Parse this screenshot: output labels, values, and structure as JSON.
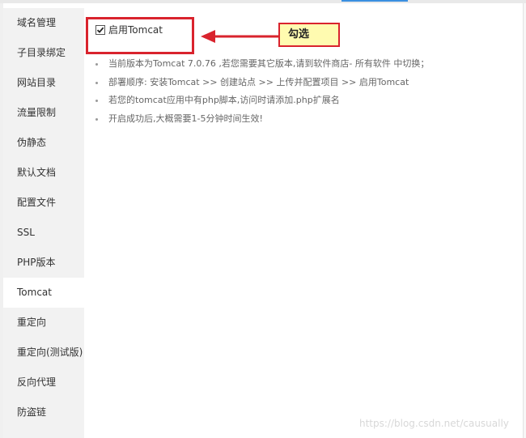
{
  "sidebar": {
    "items": [
      {
        "label": "域名管理"
      },
      {
        "label": "子目录绑定"
      },
      {
        "label": "网站目录"
      },
      {
        "label": "流量限制"
      },
      {
        "label": "伪静态"
      },
      {
        "label": "默认文档"
      },
      {
        "label": "配置文件"
      },
      {
        "label": "SSL"
      },
      {
        "label": "PHP版本"
      },
      {
        "label": "Tomcat"
      },
      {
        "label": "重定向"
      },
      {
        "label": "重定向(测试版)"
      },
      {
        "label": "反向代理"
      },
      {
        "label": "防盗链"
      }
    ],
    "active_index": 9
  },
  "tomcat": {
    "enable_label": "启用Tomcat",
    "enabled": true
  },
  "annotation": {
    "callout_label": "勾选",
    "highlight_color": "#d9232d",
    "callout_bg": "#fffbb0"
  },
  "notes": [
    "当前版本为Tomcat 7.0.76 ,若您需要其它版本,请到软件商店- 所有软件 中切换；",
    "部署顺序: 安装Tomcat >> 创建站点 >> 上传并配置项目 >> 启用Tomcat",
    "若您的tomcat应用中有php脚本,访问时请添加.php扩展名",
    "开启成功后,大概需要1-5分钟时间生效!"
  ],
  "watermark": "https://blog.csdn.net/causually"
}
